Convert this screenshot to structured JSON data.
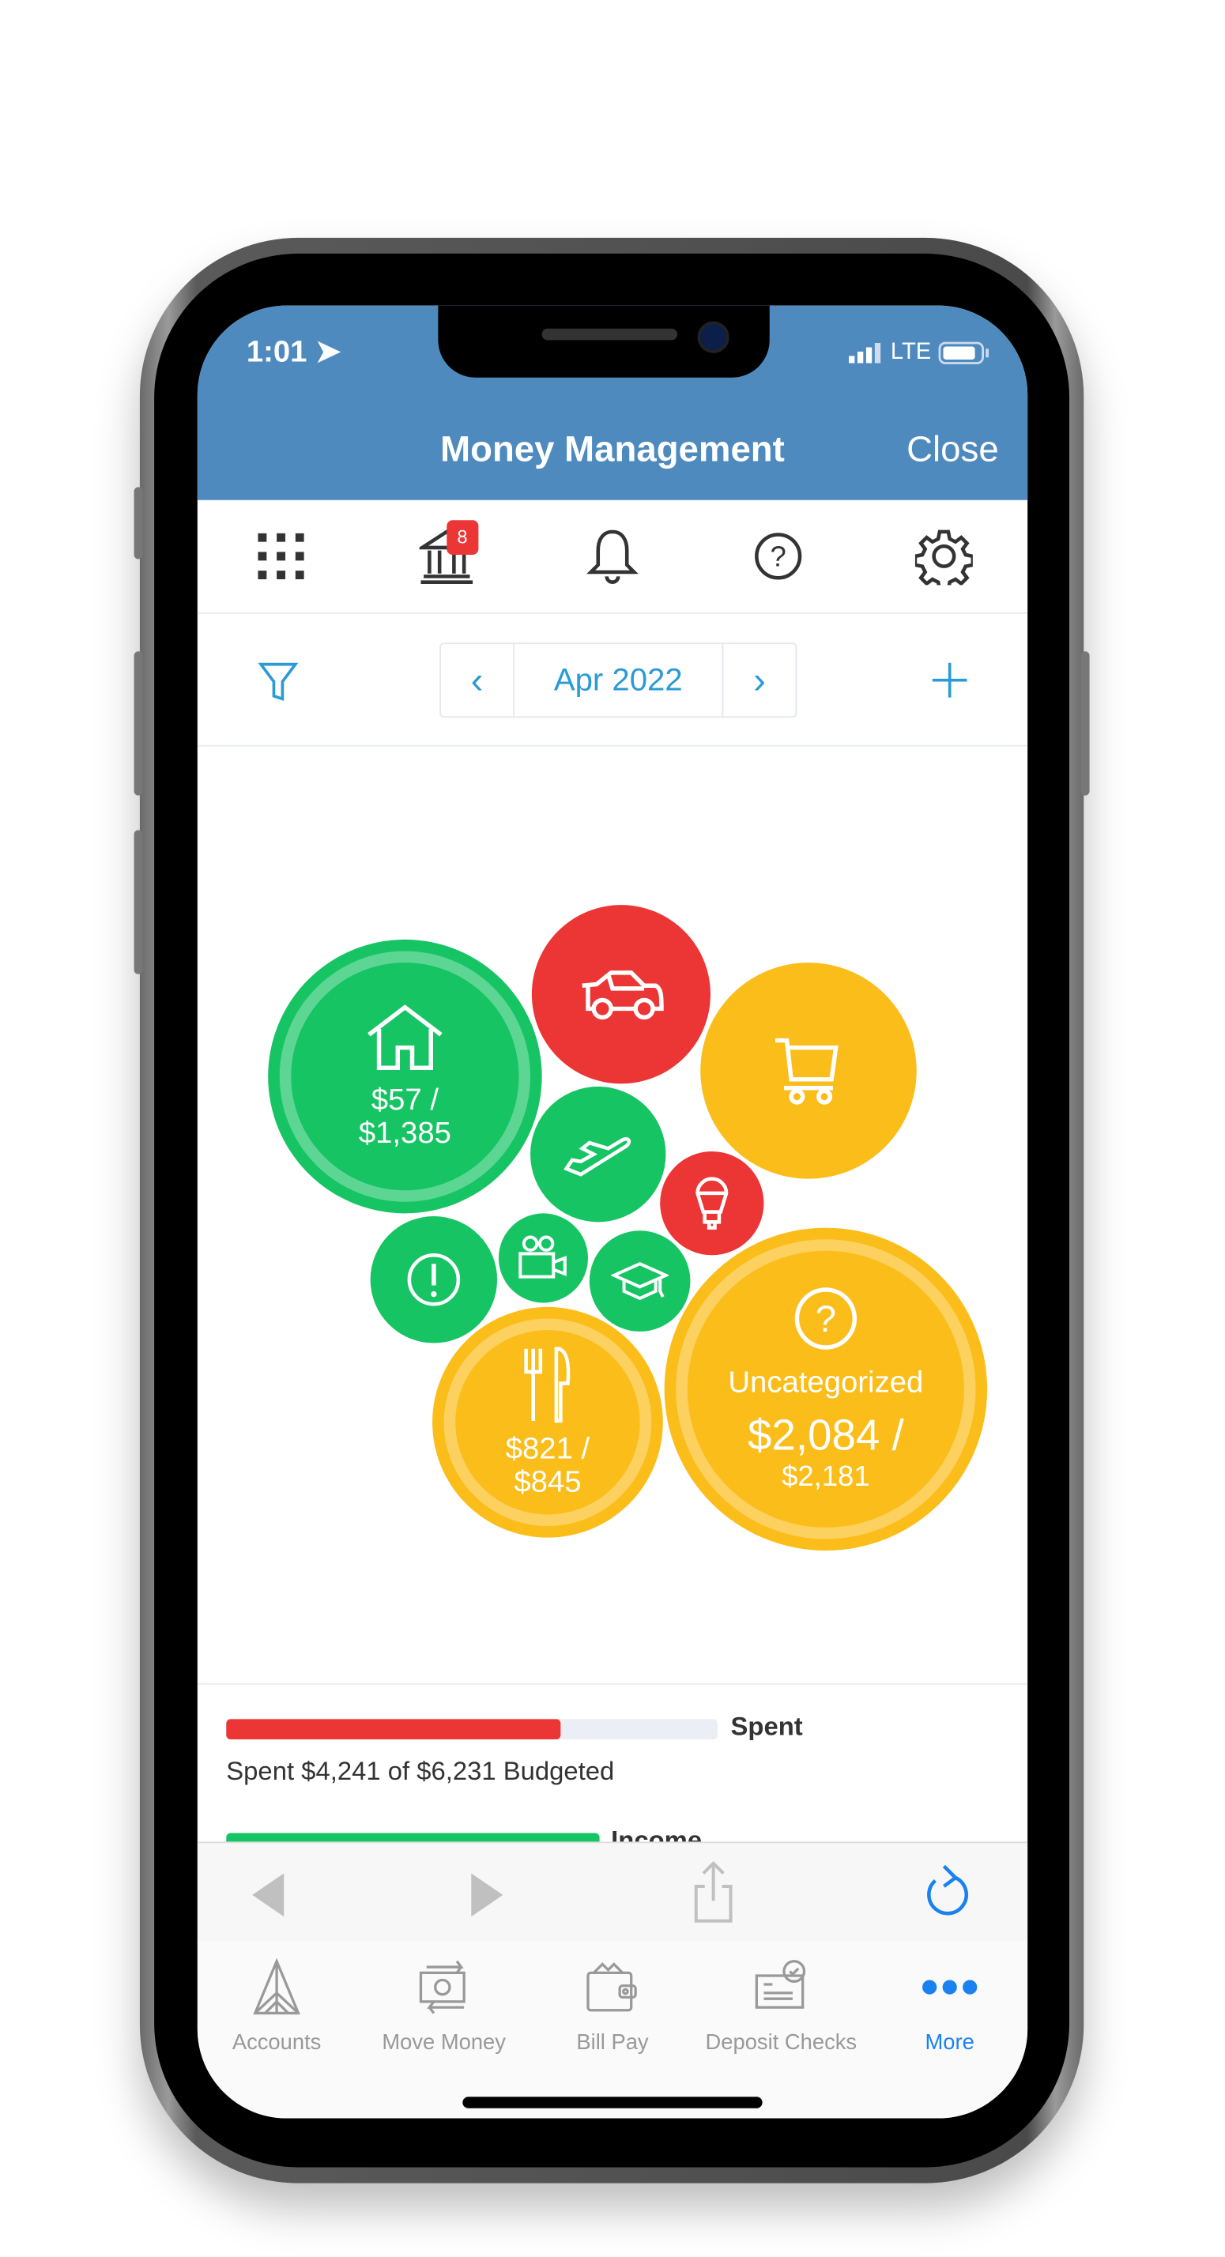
{
  "status_bar": {
    "time": "1:01",
    "network": "LTE"
  },
  "header": {
    "title": "Money Management",
    "close_label": "Close"
  },
  "toolbar": {
    "icons": [
      "apps-grid-icon",
      "bank-icon",
      "bell-icon",
      "help-icon",
      "gear-icon"
    ],
    "bank_badge": "8"
  },
  "date_nav": {
    "month": "Apr 2022",
    "prev": "‹",
    "next": "›"
  },
  "colors": {
    "header": "#4f8abf",
    "accent": "#2a9bd6",
    "green": "#16c464",
    "red": "#ec3535",
    "yellow": "#fbbd1a",
    "active_tab": "#1a82f0"
  },
  "bubbles": [
    {
      "icon": "house-icon",
      "color": "green",
      "spent": "$57 /",
      "budget": "$1,385"
    },
    {
      "icon": "car-icon",
      "color": "red"
    },
    {
      "icon": "cart-icon",
      "color": "yellow"
    },
    {
      "icon": "plane-icon",
      "color": "green"
    },
    {
      "icon": "lightbulb-icon",
      "color": "red"
    },
    {
      "icon": "alert-icon",
      "color": "green"
    },
    {
      "icon": "video-camera-icon",
      "color": "green"
    },
    {
      "icon": "graduation-cap-icon",
      "color": "green"
    },
    {
      "icon": "dining-icon",
      "color": "yellow",
      "spent": "$821 /",
      "budget": "$845"
    },
    {
      "icon": "question-icon",
      "color": "yellow",
      "label": "Uncategorized",
      "spent": "$2,084 /",
      "budget": "$2,181"
    }
  ],
  "summary": {
    "spent_label": "Spent",
    "spent_text": "Spent $4,241 of $6,231 Budgeted",
    "spent_fraction": 0.68,
    "income_label": "Income"
  },
  "tabs": [
    {
      "label": "Accounts",
      "icon": "accounts-icon"
    },
    {
      "label": "Move Money",
      "icon": "move-money-icon"
    },
    {
      "label": "Bill Pay",
      "icon": "wallet-icon"
    },
    {
      "label": "Deposit Checks",
      "icon": "deposit-check-icon"
    },
    {
      "label": "More",
      "icon": "more-icon",
      "active": true
    }
  ]
}
